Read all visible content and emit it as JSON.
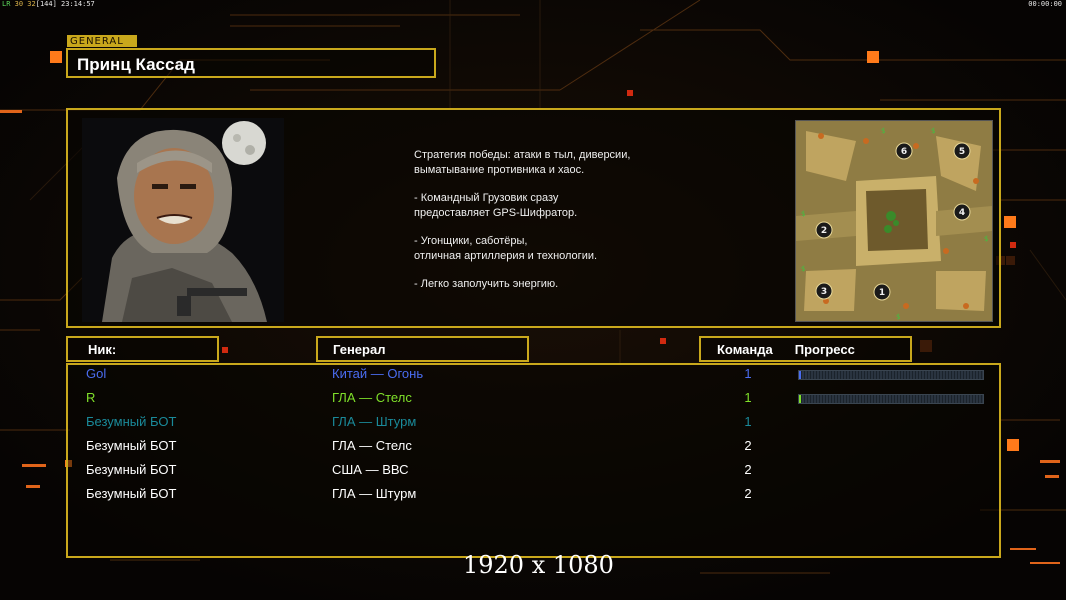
{
  "overlay": {
    "fps_label": "LR",
    "fps_values": "30 32",
    "fps_extra": "[144]",
    "clock": "23:14:57",
    "timer": "00:00:00"
  },
  "general": {
    "tag": "GENERAL",
    "name": "Принц Кассад",
    "strategy": [
      "Стратегия победы: атаки в тыл, диверсии,\n выматывание противника и хаос.",
      "- Командный Грузовик сразу\nпредоставляет GPS-Шифратор.",
      "- Угонщики, саботёры,\nотличная артиллерия и технологии.",
      "- Легко заполучить энергию."
    ]
  },
  "minimap": {
    "start_positions": [
      "1",
      "2",
      "3",
      "4",
      "5",
      "6"
    ]
  },
  "table": {
    "headers": {
      "nick": "Ник:",
      "general": "Генерал",
      "team": "Команда",
      "progress": "Прогресс"
    },
    "players": [
      {
        "nick": "Gol",
        "general": "Китай — Огонь",
        "team": "1",
        "color": "#4a6cf0",
        "progress": 0.01
      },
      {
        "nick": "R",
        "general": "ГЛА — Стелс",
        "team": "1",
        "color": "#7fe02a",
        "progress": 0.01
      },
      {
        "nick": "Безумный БОТ",
        "general": "ГЛА — Штурм",
        "team": "1",
        "color": "#1a8a9a",
        "progress": null
      },
      {
        "nick": "Безумный БОТ",
        "general": "ГЛА — Стелс",
        "team": "2",
        "color": "#ffffff",
        "progress": null
      },
      {
        "nick": "Безумный БОТ",
        "general": "США — ВВС",
        "team": "2",
        "color": "#ffffff",
        "progress": null
      },
      {
        "nick": "Безумный БОТ",
        "general": "ГЛА — Штурм",
        "team": "2",
        "color": "#ffffff",
        "progress": null
      }
    ]
  },
  "resolution_watermark": "1920 x 1080"
}
